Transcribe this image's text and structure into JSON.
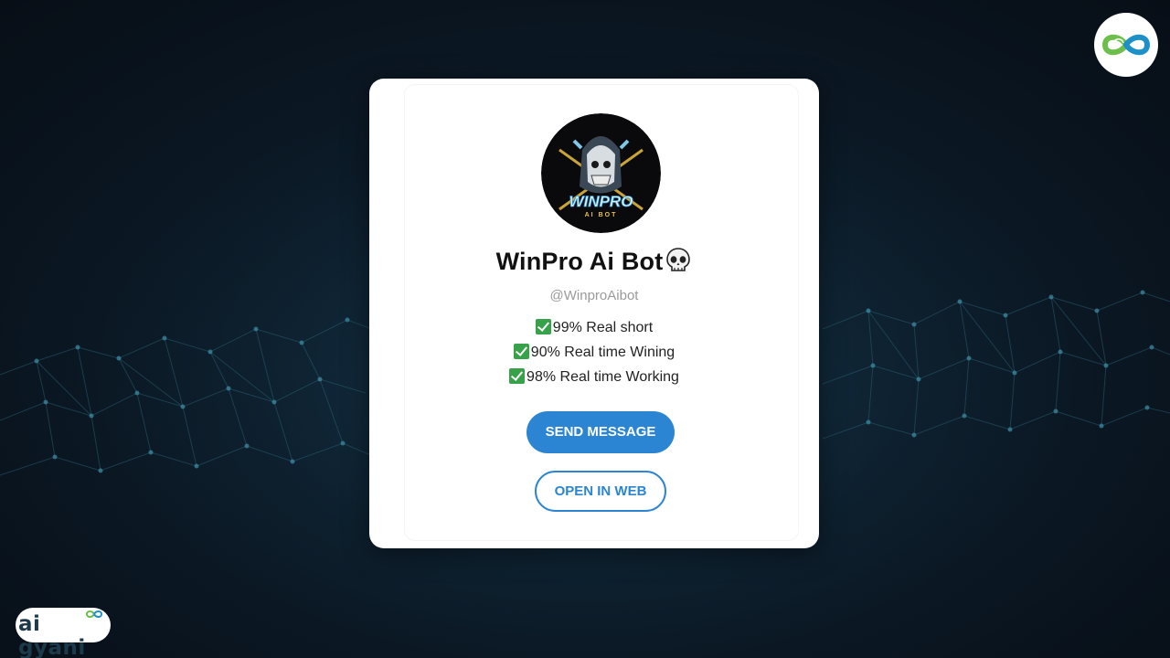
{
  "bot": {
    "name": "WinPro Ai Bot",
    "emoji": "skull-icon",
    "username": "@WinproAibot",
    "avatar_text_main": "WINPRO",
    "avatar_text_sub": "AI BOT",
    "description": [
      "99% Real short",
      "90% Real time Wining",
      "98% Real time Working"
    ]
  },
  "buttons": {
    "send_message": "SEND MESSAGE",
    "open_in_web": "OPEN IN WEB"
  },
  "branding": {
    "corner_logo": "infinity-leaf-icon",
    "watermark_text": "ai gyani"
  },
  "colors": {
    "accent": "#2b85d2",
    "check": "#37a24a",
    "background": "#0c1a27"
  }
}
